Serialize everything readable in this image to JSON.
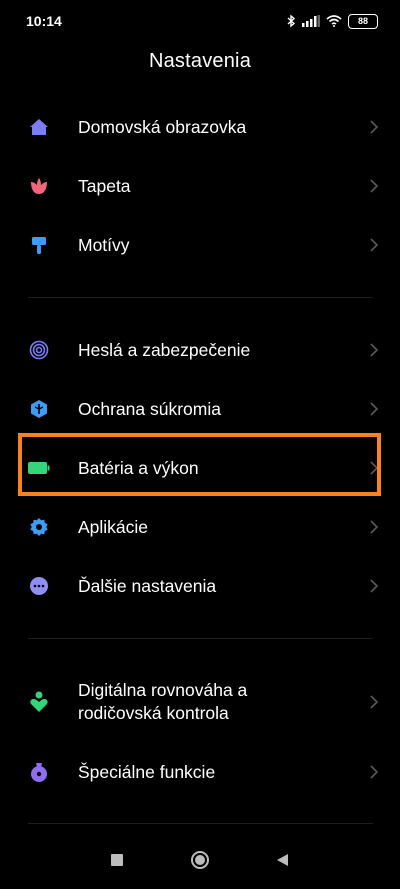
{
  "status_bar": {
    "time": "10:14",
    "battery_level": "88",
    "icons": [
      "bluetooth-icon",
      "signal-icon",
      "wifi-icon",
      "battery-icon"
    ]
  },
  "header": {
    "title": "Nastavenia"
  },
  "settings": {
    "items": [
      {
        "label": "Domovská obrazovka",
        "icon": "home-icon",
        "color": "#7b7cf7"
      },
      {
        "label": "Tapeta",
        "icon": "flower-icon",
        "color": "#f0657b"
      },
      {
        "label": "Motívy",
        "icon": "brush-icon",
        "color": "#3f9cf5"
      },
      {
        "label": "Heslá a zabezpečenie",
        "icon": "fingerprint-icon",
        "color": "#7b7cf7"
      },
      {
        "label": "Ochrana súkromia",
        "icon": "privacy-icon",
        "color": "#3f9cf5"
      },
      {
        "label": "Batéria a výkon",
        "icon": "battery-icon",
        "color": "#35d47a"
      },
      {
        "label": "Aplikácie",
        "icon": "gear-icon",
        "color": "#3f9cf5"
      },
      {
        "label": "Ďalšie nastavenia",
        "icon": "more-icon",
        "color": "#8f8ef5"
      },
      {
        "label_line1": "Digitálna rovnováha a",
        "label_line2": "rodičovská kontrola",
        "icon": "wellbeing-icon",
        "color": "#35d47a"
      },
      {
        "label": "Špeciálne funkcie",
        "icon": "accessibility-icon",
        "color": "#8f6ef0"
      }
    ]
  },
  "highlight_color": "#f7831f",
  "navigation": {
    "buttons": [
      "recents-button",
      "home-button",
      "back-button"
    ]
  }
}
